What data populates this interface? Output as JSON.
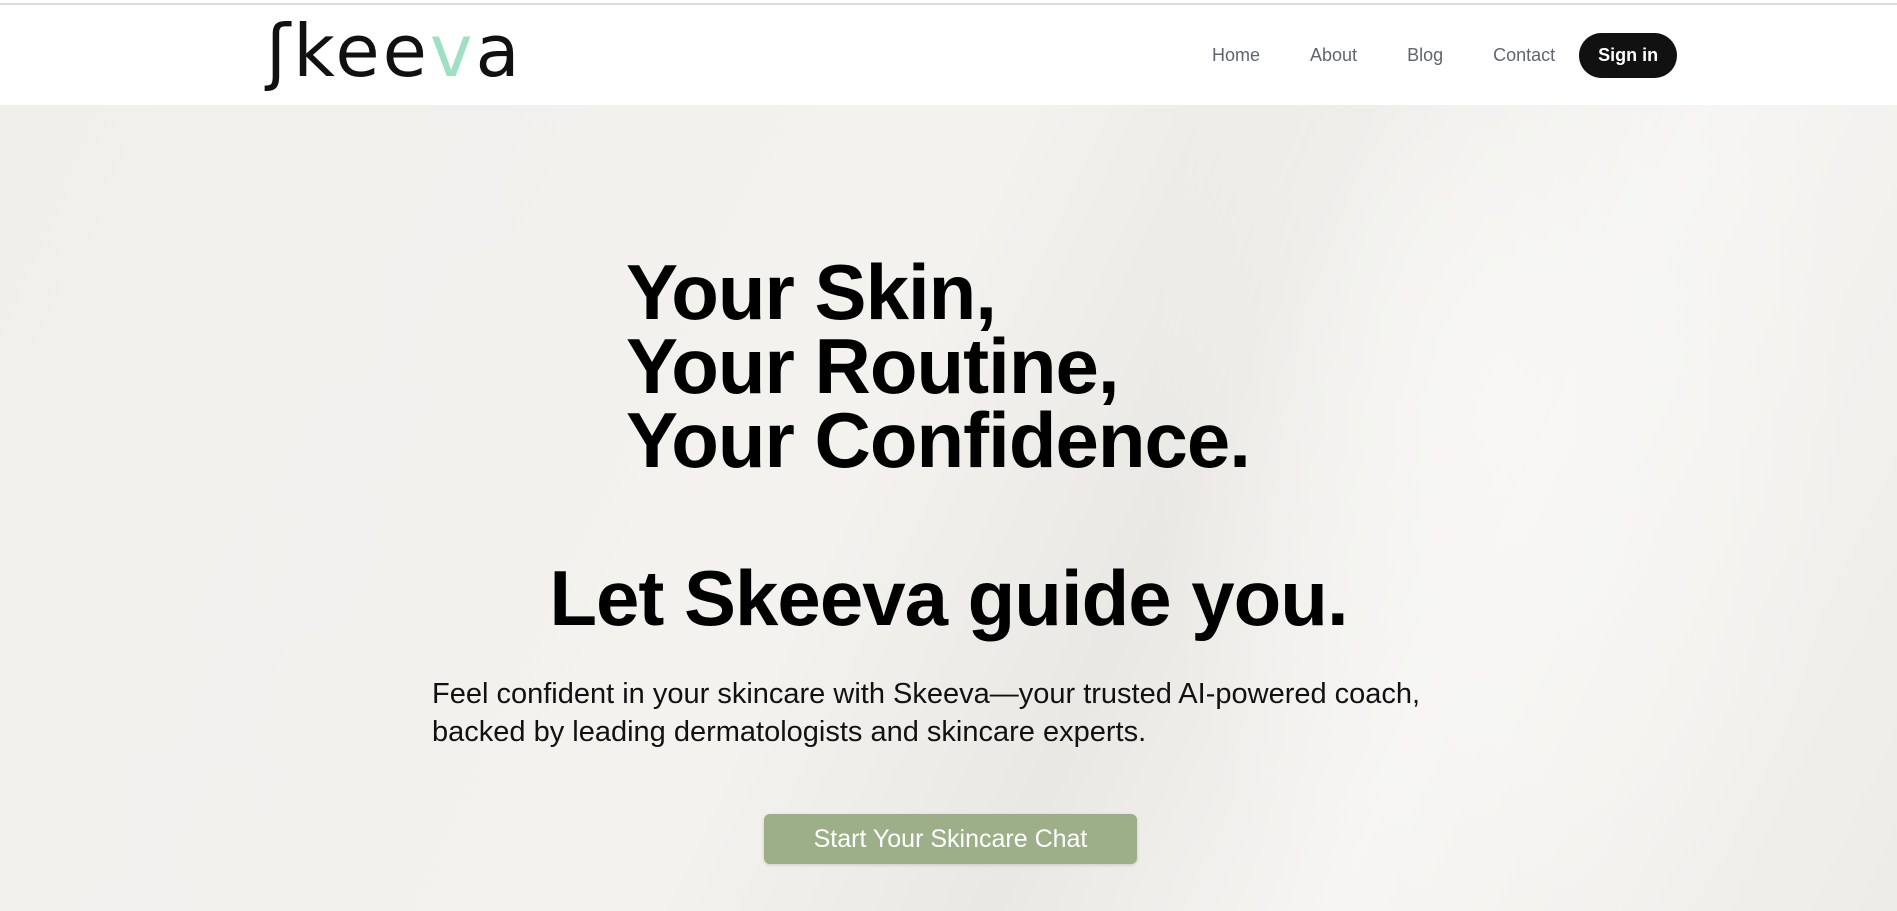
{
  "brand": {
    "logo_prefix": "ʃkee",
    "logo_accent": "v",
    "logo_suffix": "a",
    "accent_color": "#9fe0c2"
  },
  "nav": {
    "items": [
      "Home",
      "About",
      "Blog",
      "Contact"
    ],
    "signin": "Sign in"
  },
  "hero": {
    "lines": [
      "Your Skin,",
      "Your Routine,",
      "Your Confidence."
    ],
    "subheading": "Let Skeeva guide you.",
    "description_line1": "Feel confident in your skincare with Skeeva—your trusted AI-powered coach,",
    "description_line2": "backed by leading dermatologists and skincare experts.",
    "cta": "Start Your Skincare Chat",
    "cta_color": "#9daf89"
  }
}
